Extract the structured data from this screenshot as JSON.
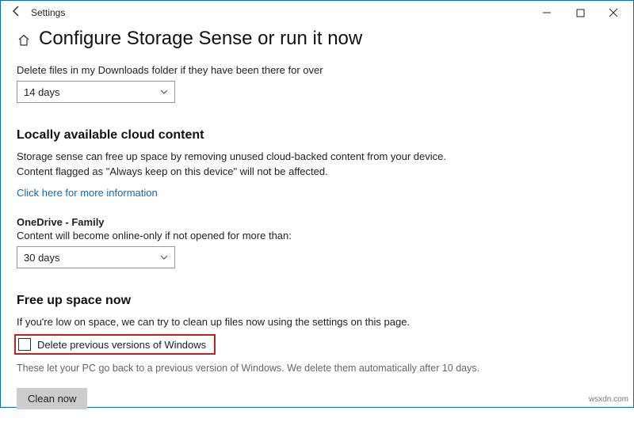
{
  "window": {
    "title": "Settings"
  },
  "page": {
    "title": "Configure Storage Sense or run it now"
  },
  "downloads": {
    "label": "Delete files in my Downloads folder if they have been there for over",
    "selected": "14 days"
  },
  "cloud": {
    "heading": "Locally available cloud content",
    "line1": "Storage sense can free up space by removing unused cloud-backed content from your device.",
    "line2": "Content flagged as \"Always keep on this device\" will not be affected.",
    "link": "Click here for more information"
  },
  "onedrive": {
    "heading": "OneDrive - Family",
    "label": "Content will become online-only if not opened for more than:",
    "selected": "30 days"
  },
  "freeup": {
    "heading": "Free up space now",
    "desc": "If you're low on space, we can try to clean up files now using the settings on this page.",
    "checkbox_label": "Delete previous versions of Windows",
    "note": "These let your PC go back to a previous version of Windows. We delete them automatically after 10 days.",
    "button": "Clean now"
  },
  "watermark": "wsxdn.com"
}
